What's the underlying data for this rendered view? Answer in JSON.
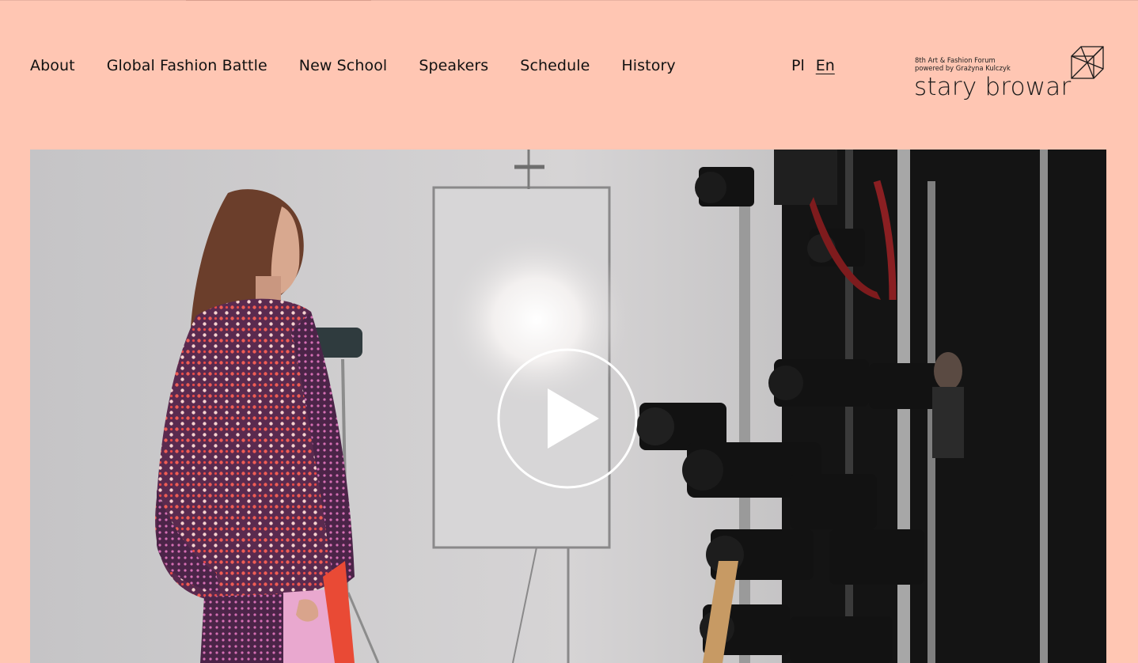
{
  "nav": {
    "items": [
      {
        "label": "About"
      },
      {
        "label": "Global Fashion Battle"
      },
      {
        "label": "New School"
      },
      {
        "label": "Speakers"
      },
      {
        "label": "Schedule"
      },
      {
        "label": "History"
      }
    ]
  },
  "language": {
    "options": [
      {
        "label": "Pl",
        "active": false
      },
      {
        "label": "En",
        "active": true
      }
    ]
  },
  "logo": {
    "tagline_line1": "8th Art & Fashion Forum",
    "tagline_line2": "powered by Grażyna Kulczyk",
    "wordmark": "stary browar",
    "icon": "wireframe-cube-icon"
  },
  "video": {
    "play_icon": "play-icon"
  },
  "colors": {
    "background": "#ffc6b3",
    "text": "#111111"
  }
}
